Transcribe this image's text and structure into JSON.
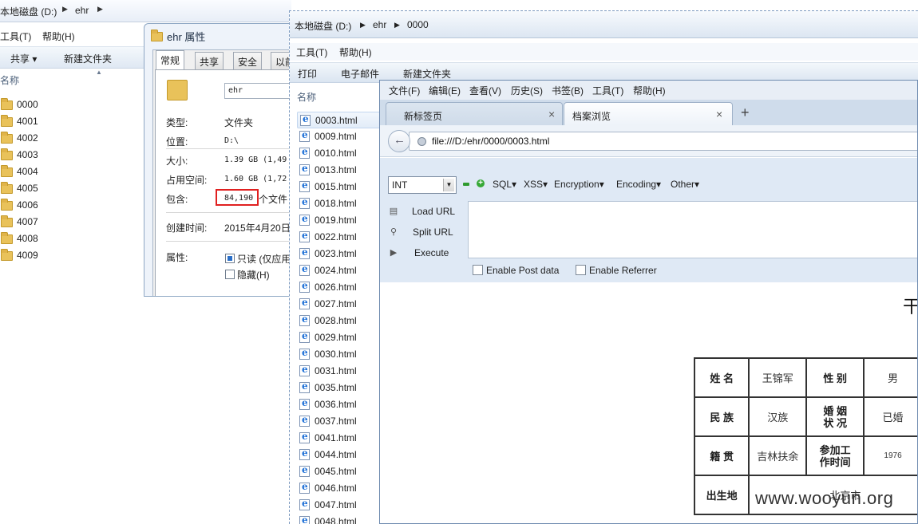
{
  "explorer_back": {
    "breadcrumb": [
      "本地磁盘 (D:)",
      "ehr"
    ],
    "menu": [
      "工具(T)",
      "帮助(H)"
    ],
    "toolbar": [
      "共享 ▾",
      "新建文件夹"
    ],
    "column_header": "名称",
    "folders": [
      "0000",
      "4001",
      "4002",
      "4003",
      "4004",
      "4005",
      "4006",
      "4007",
      "4008",
      "4009"
    ]
  },
  "properties": {
    "title": "ehr 属性",
    "tabs": [
      "常规",
      "共享",
      "安全",
      "以前"
    ],
    "name_value": "ehr",
    "rows": {
      "type_label": "类型:",
      "type_value": "文件夹",
      "location_label": "位置:",
      "location_value": "D:\\",
      "size_label": "大小:",
      "size_value": "1.39 GB (1,49",
      "disk_label": "占用空间:",
      "disk_value": "1.60 GB (1,72",
      "contains_label": "包含:",
      "contains_value": "84,190",
      "contains_suffix": "个文件",
      "created_label": "创建时间:",
      "created_value": "2015年4月20日",
      "attr_label": "属性:",
      "readonly_label": "只读 (仅应用",
      "hidden_label": "隐藏(H)"
    },
    "highlight_color": "#e02020"
  },
  "explorer_front": {
    "breadcrumb": [
      "本地磁盘 (D:)",
      "ehr",
      "0000"
    ],
    "menu": [
      "工具(T)",
      "帮助(H)"
    ],
    "toolbar": [
      "打印",
      "电子邮件",
      "新建文件夹"
    ],
    "column_header": "名称",
    "files": [
      "0003.html",
      "0009.html",
      "0010.html",
      "0013.html",
      "0015.html",
      "0018.html",
      "0019.html",
      "0022.html",
      "0023.html",
      "0024.html",
      "0026.html",
      "0027.html",
      "0028.html",
      "0029.html",
      "0030.html",
      "0031.html",
      "0035.html",
      "0036.html",
      "0037.html",
      "0041.html",
      "0044.html",
      "0045.html",
      "0046.html",
      "0047.html",
      "0048.html"
    ]
  },
  "firefox": {
    "menu": [
      "文件(F)",
      "编辑(E)",
      "查看(V)",
      "历史(S)",
      "书签(B)",
      "工具(T)",
      "帮助(H)"
    ],
    "tabs": [
      {
        "label": "新标签页",
        "close": "×"
      },
      {
        "label": "档案浏览",
        "close": "×"
      }
    ],
    "new_tab": "+",
    "url": "file:///D:/ehr/0000/0003.html",
    "hackbar": {
      "select_value": "INT",
      "menus": [
        "SQL▾",
        "XSS▾",
        "Encryption▾",
        "Encoding▾",
        "Other▾"
      ],
      "actions": [
        "Load URL",
        "Split URL",
        "Execute"
      ],
      "checkboxes": [
        "Enable Post data",
        "Enable Referrer"
      ]
    },
    "page": {
      "title_fragment": "干",
      "table": [
        [
          "姓 名",
          "王锦军",
          "性 别",
          "男"
        ],
        [
          "民 族",
          "汉族",
          "婚 姻\n状 况",
          "已婚"
        ],
        [
          "籍 贯",
          "吉林扶余",
          "参加工\n作时间",
          "1976"
        ],
        [
          "出生地",
          "北京市",
          "",
          ""
        ]
      ]
    },
    "watermark": "www.wooyun.org"
  }
}
